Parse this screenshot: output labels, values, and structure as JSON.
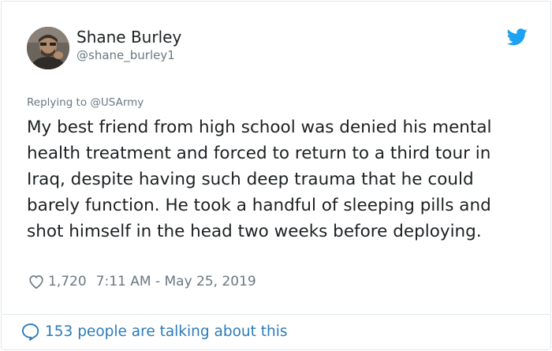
{
  "tweet": {
    "author": {
      "name": "Shane Burley",
      "handle": "@shane_burley1"
    },
    "replying_to": "Replying to @USArmy",
    "text": "My best friend from high school was denied his mental health treatment and forced to return to a third tour in Iraq, despite having such deep trauma that he could barely function. He took a handful of sleeping pills and shot himself in the head two weeks before deploying.",
    "likes": "1,720",
    "timestamp": "7:11 AM - May 25, 2019",
    "conversation_label": "153 people are talking about this"
  },
  "icons": {
    "brand": "twitter-bird-icon",
    "like": "heart-icon",
    "conversation": "speech-bubble-icon"
  },
  "colors": {
    "brand": "#1da1f2",
    "link": "#2b7bb9",
    "secondary_text": "#697882",
    "primary_text": "#1c2022",
    "border": "#e1e8ed"
  }
}
